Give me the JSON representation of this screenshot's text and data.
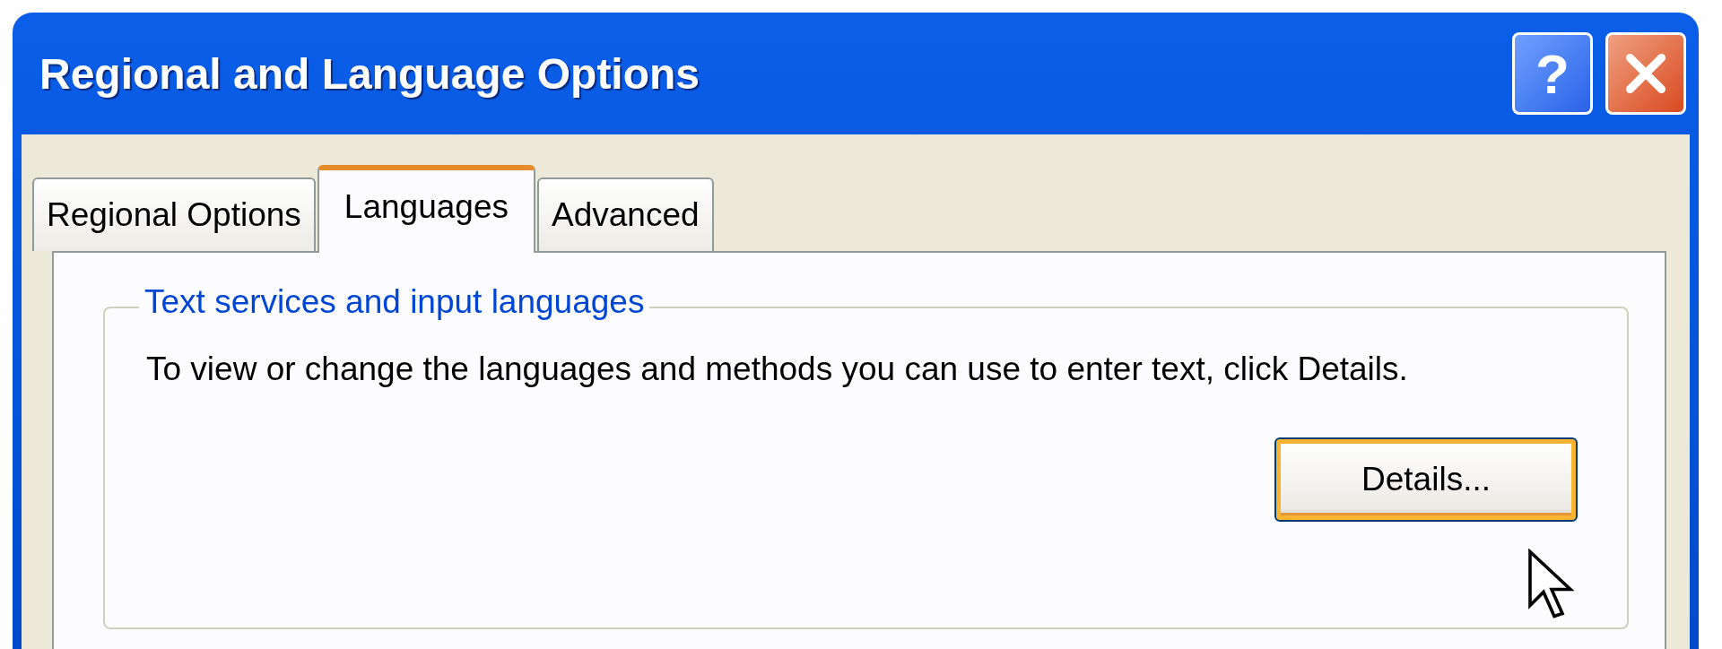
{
  "window": {
    "title": "Regional and Language Options",
    "help_button": {
      "label": "?"
    }
  },
  "tabs": [
    {
      "label": "Regional Options",
      "selected": false
    },
    {
      "label": "Languages",
      "selected": true
    },
    {
      "label": "Advanced",
      "selected": false
    }
  ],
  "group": {
    "title": "Text services and input languages",
    "description": "To view or change the languages and methods you can use to enter text, click Details.",
    "button": {
      "label": "Details...",
      "hovered": true
    }
  }
}
